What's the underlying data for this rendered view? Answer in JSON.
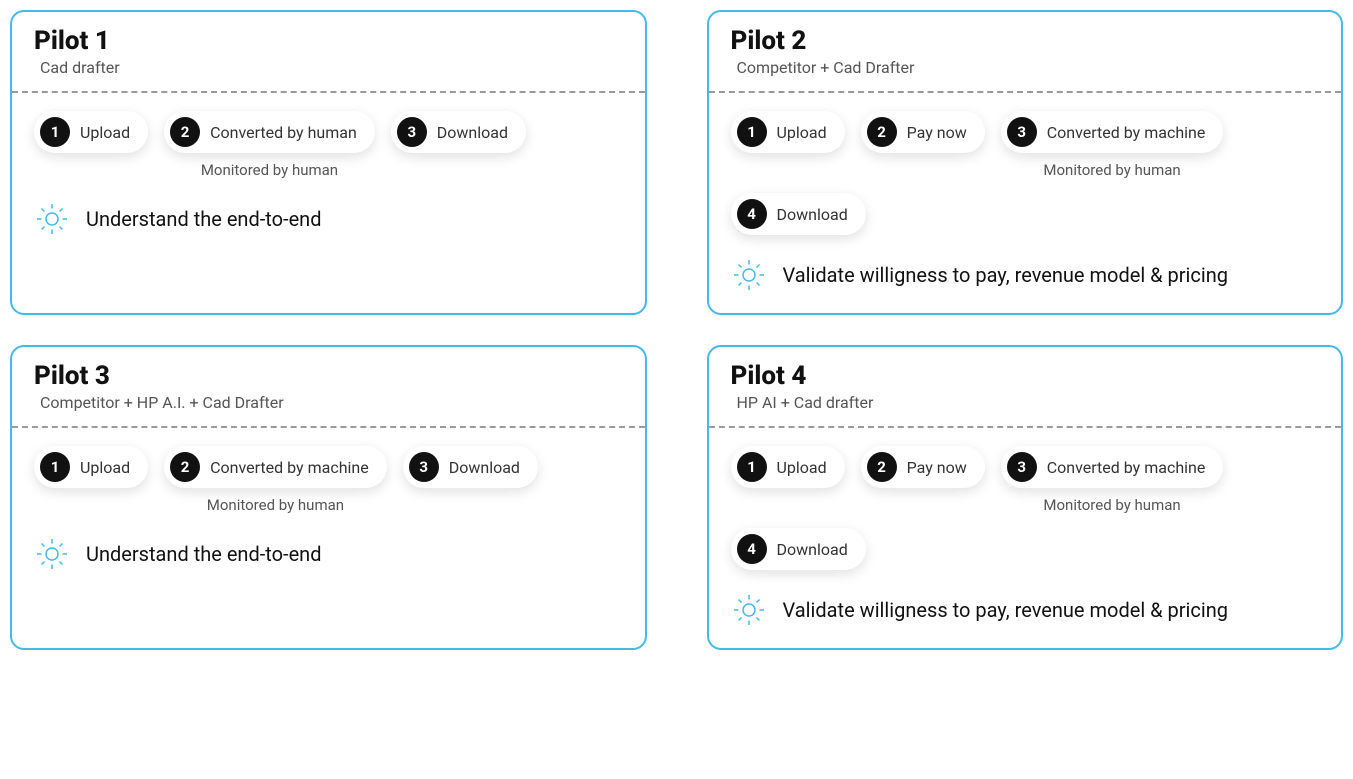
{
  "pilots": [
    {
      "title": "Pilot 1",
      "subtitle": "Cad drafter",
      "steps": [
        {
          "num": "1",
          "label": "Upload",
          "note": ""
        },
        {
          "num": "2",
          "label": "Converted by human",
          "note": "Monitored by human"
        },
        {
          "num": "3",
          "label": "Download",
          "note": ""
        }
      ],
      "insight": "Understand the end-to-end"
    },
    {
      "title": "Pilot 2",
      "subtitle": "Competitor + Cad Drafter",
      "steps": [
        {
          "num": "1",
          "label": "Upload",
          "note": ""
        },
        {
          "num": "2",
          "label": "Pay now",
          "note": ""
        },
        {
          "num": "3",
          "label": "Converted by machine",
          "note": "Monitored by human"
        },
        {
          "num": "4",
          "label": "Download",
          "note": ""
        }
      ],
      "insight": "Validate willigness to pay, revenue model & pricing"
    },
    {
      "title": "Pilot 3",
      "subtitle": "Competitor + HP A.I. + Cad Drafter",
      "steps": [
        {
          "num": "1",
          "label": "Upload",
          "note": ""
        },
        {
          "num": "2",
          "label": "Converted by machine",
          "note": "Monitored by human"
        },
        {
          "num": "3",
          "label": "Download",
          "note": ""
        }
      ],
      "insight": "Understand the end-to-end"
    },
    {
      "title": "Pilot 4",
      "subtitle": "HP AI + Cad drafter",
      "steps": [
        {
          "num": "1",
          "label": "Upload",
          "note": ""
        },
        {
          "num": "2",
          "label": "Pay now",
          "note": ""
        },
        {
          "num": "3",
          "label": "Converted by machine",
          "note": "Monitored by human"
        },
        {
          "num": "4",
          "label": "Download",
          "note": ""
        }
      ],
      "insight": "Validate willigness to pay, revenue model & pricing"
    }
  ]
}
